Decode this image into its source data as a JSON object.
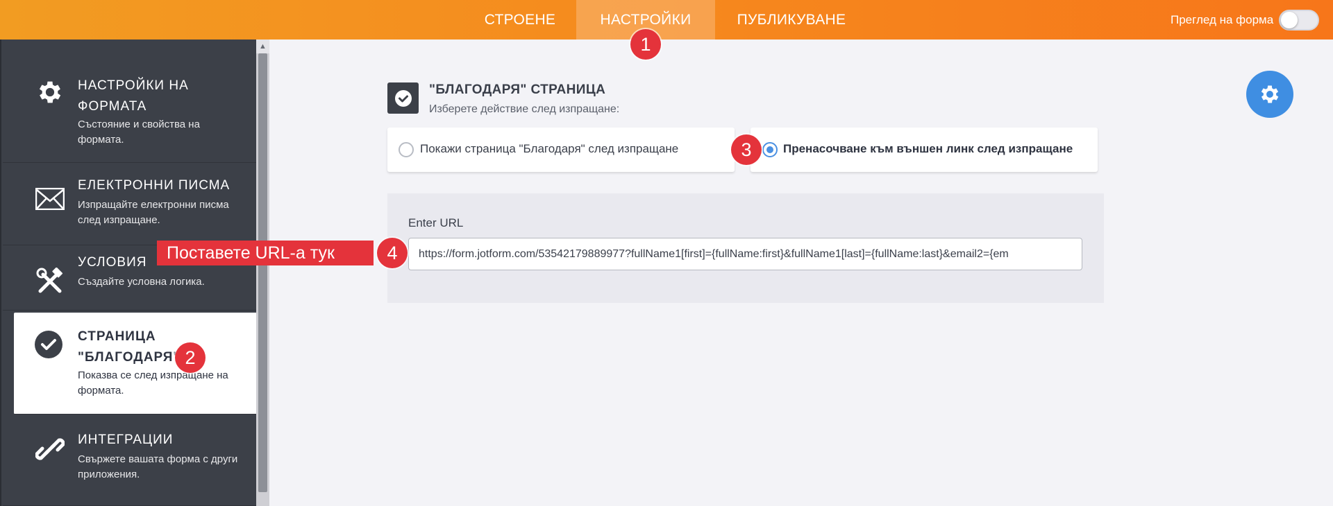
{
  "topbar": {
    "tabs": [
      {
        "label": "СТРОЕНЕ"
      },
      {
        "label": "НАСТРОЙКИ"
      },
      {
        "label": "ПУБЛИКУВАНЕ"
      }
    ],
    "active_tab": "НАСТРОЙКИ",
    "preview_label": "Преглед на форма",
    "preview_enabled": false,
    "gradient": [
      "#f29c22",
      "#f7761a"
    ]
  },
  "sidebar": {
    "items": [
      {
        "icon": "gear-icon",
        "title": "НАСТРОЙКИ НА ФОРМАТА",
        "desc": "Състояние и свойства на формата."
      },
      {
        "icon": "envelope-icon",
        "title": "ЕЛЕКТРОННИ ПИСМА",
        "desc": "Изпращайте електронни писма след изпращане."
      },
      {
        "icon": "tools-icon",
        "title": "УСЛОВИЯ",
        "desc": "Създайте условна логика."
      },
      {
        "icon": "check-circle-icon",
        "title": "СТРАНИЦА \"БЛАГОДАРЯ\"",
        "desc": "Показва се след изпращане на формата."
      },
      {
        "icon": "link-icon",
        "title": "ИНТЕГРАЦИИ",
        "desc": "Свържете вашата форма с други приложения."
      }
    ],
    "active_index": 3
  },
  "main": {
    "section_title": "\"БЛАГОДАРЯ\" СТРАНИЦА",
    "section_subtitle": "Изберете действие след изпращане:",
    "options": [
      {
        "label": "Покажи страница \"Благодаря\" след изпращане",
        "checked": false
      },
      {
        "label": "Пренасочване към външен линк след изпращане",
        "checked": true
      }
    ],
    "url_field": {
      "label": "Enter URL",
      "value": "https://form.jotform.com/53542179889977?fullName1[first]={fullName:first}&fullName1[last]={fullName:last}&email2={em"
    },
    "accent_color": "#4a90e2"
  },
  "annotations": {
    "badges": [
      "1",
      "2",
      "3",
      "4"
    ],
    "callout_text": "Поставете URL-а тук",
    "color": "#e4333b"
  }
}
